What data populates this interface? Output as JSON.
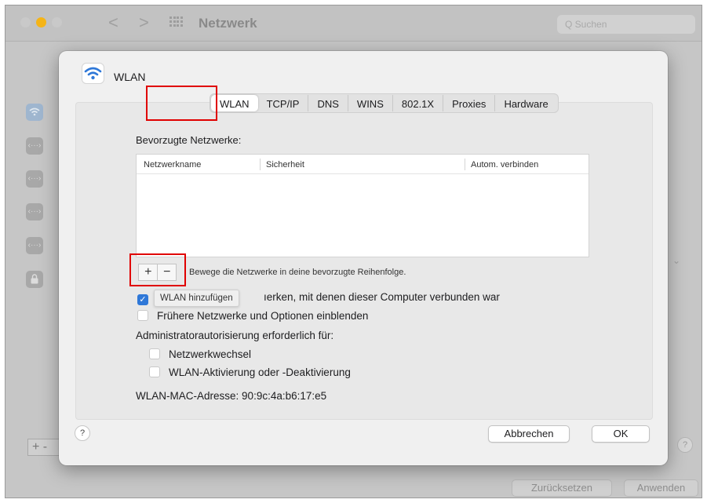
{
  "background_window": {
    "title": "Netzwerk",
    "back_symbol": "<",
    "forward_symbol": ">",
    "search_placeholder": "Q Suchen",
    "sidebar_plus": "+ -",
    "help_symbol": "?",
    "reset_button": "Zurücksetzen",
    "apply_button": "Anwenden"
  },
  "sheet": {
    "title": "WLAN",
    "tabs": [
      "WLAN",
      "TCP/IP",
      "DNS",
      "WINS",
      "802.1X",
      "Proxies",
      "Hardware"
    ],
    "active_tab": "WLAN",
    "preferred_networks_label": "Bevorzugte Netzwerke:",
    "table": {
      "columns": [
        "Netzwerkname",
        "Sicherheit",
        "Autom. verbinden"
      ],
      "rows": []
    },
    "add_symbol": "+",
    "remove_symbol": "−",
    "reorder_hint": "Bewege die Netzwerke in deine bevorzugte Reihenfolge.",
    "tooltip": "WLAN hinzufügen",
    "remember_networks_text": "ıerken, mit denen dieser Computer verbunden war",
    "remember_networks_checked": true,
    "show_legacy_label": "Frühere Netzwerke und Optionen einblenden",
    "show_legacy_checked": false,
    "admin_auth_label": "Administratorautorisierung erforderlich für:",
    "network_change_label": "Netzwerkwechsel",
    "network_change_checked": false,
    "wifi_toggle_label": "WLAN-Aktivierung oder -Deaktivierung",
    "wifi_toggle_checked": false,
    "mac_label": "WLAN-MAC-Adresse:",
    "mac_value": "90:9c:4a:b6:17:e5",
    "help_symbol": "?",
    "cancel_button": "Abbrechen",
    "ok_button": "OK"
  },
  "colors": {
    "highlight_box": "#e00000",
    "checkbox_on": "#2f78d8",
    "wifi_icon": "#2f78d8"
  }
}
